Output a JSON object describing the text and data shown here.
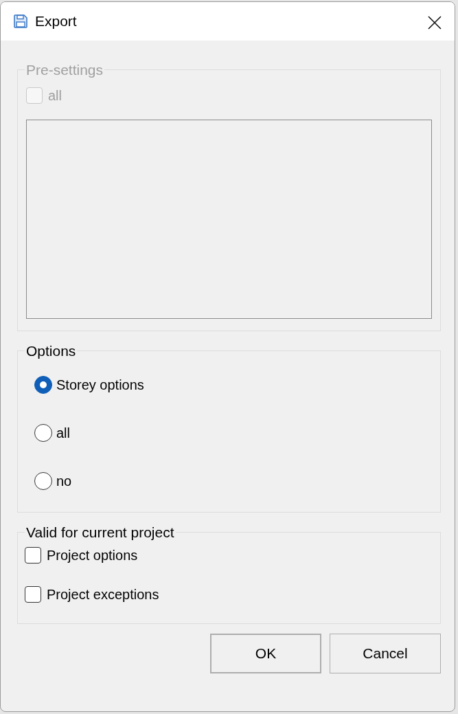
{
  "window": {
    "title": "Export"
  },
  "presettings": {
    "title": "Pre-settings",
    "disabled": true,
    "all_checkbox": {
      "label": "all",
      "checked": false
    }
  },
  "options": {
    "title": "Options",
    "radios": [
      {
        "label": "Storey options",
        "selected": true
      },
      {
        "label": "all",
        "selected": false
      },
      {
        "label": "no",
        "selected": false
      }
    ]
  },
  "valid": {
    "title": "Valid for current project",
    "checkboxes": [
      {
        "label": "Project options",
        "checked": false
      },
      {
        "label": "Project exceptions",
        "checked": false
      }
    ]
  },
  "buttons": [
    {
      "label": "OK",
      "default": true
    },
    {
      "label": "Cancel",
      "default": false
    }
  ]
}
